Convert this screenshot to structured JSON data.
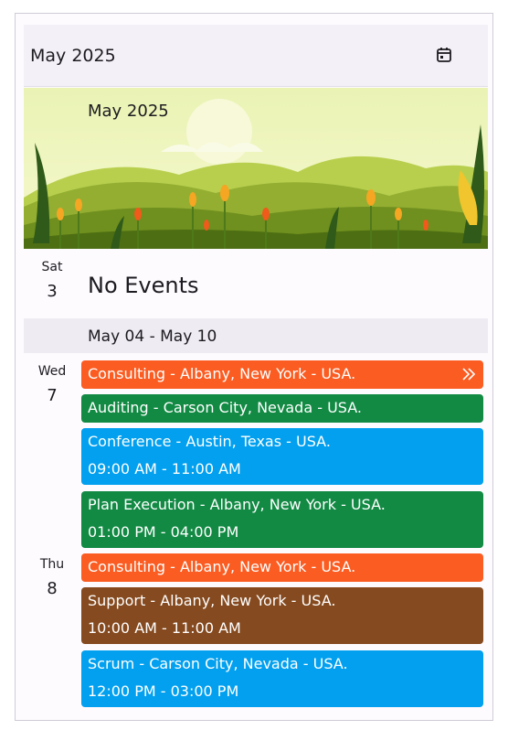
{
  "header": {
    "title": "May 2025",
    "calendar_icon": "calendar-icon"
  },
  "banner": {
    "title": "May 2025"
  },
  "days": [
    {
      "dow": "Sat",
      "num": "3",
      "empty_text": "No Events"
    },
    {
      "dow": "Wed",
      "num": "7"
    },
    {
      "dow": "Thu",
      "num": "8"
    }
  ],
  "week_header": "May 04 - May 10",
  "events": [
    {
      "title": "Consulting - Albany, New York - USA.",
      "time": "",
      "color": "#fb5c21",
      "more_icon": "double-chevron-right-icon"
    },
    {
      "title": "Auditing - Carson City, Nevada - USA.",
      "time": "",
      "color": "#128a44"
    },
    {
      "title": "Conference - Austin, Texas - USA.",
      "time": "09:00 AM - 11:00 AM",
      "color": "#02a0ef"
    },
    {
      "title": "Plan Execution - Albany, New York - USA.",
      "time": "01:00 PM - 04:00 PM",
      "color": "#128a44"
    },
    {
      "title": "Consulting - Albany, New York - USA.",
      "time": "",
      "color": "#fb5c21"
    },
    {
      "title": "Support - Albany, New York - USA.",
      "time": "10:00 AM - 11:00 AM",
      "color": "#854a1f"
    },
    {
      "title": "Scrum - Carson City, Nevada - USA.",
      "time": "12:00 PM - 03:00 PM",
      "color": "#02a0ef"
    }
  ]
}
